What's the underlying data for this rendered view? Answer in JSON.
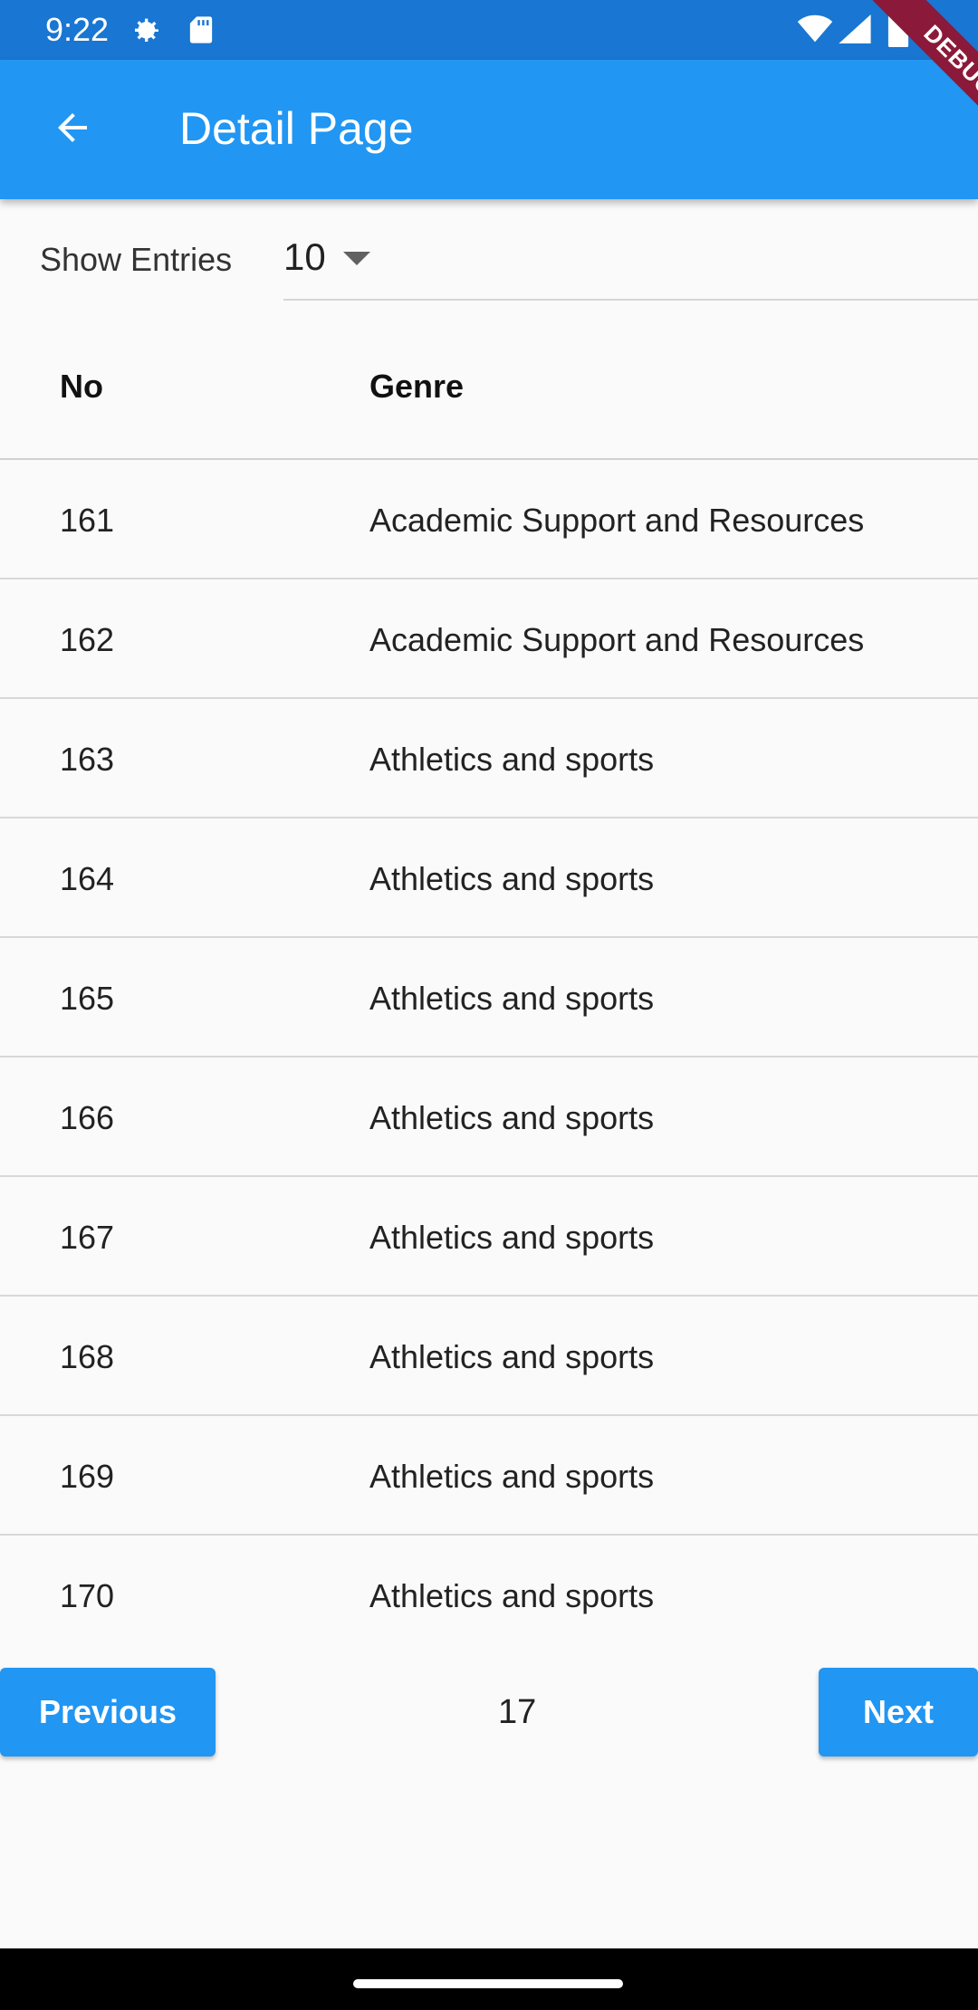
{
  "status_bar": {
    "time": "9:22",
    "icons": [
      "gear-icon",
      "sd-card-icon",
      "wifi-icon",
      "signal-icon",
      "battery-icon"
    ]
  },
  "app_bar": {
    "title": "Detail Page",
    "back_icon": "arrow-back-icon",
    "background": "#2196f3"
  },
  "debug_banner": {
    "label": "DEBUG"
  },
  "entries": {
    "label": "Show Entries",
    "selected": "10"
  },
  "table": {
    "headers": {
      "no": "No",
      "genre": "Genre"
    },
    "rows": [
      {
        "no": "161",
        "genre": "Academic Support and Resources"
      },
      {
        "no": "162",
        "genre": "Academic Support and Resources"
      },
      {
        "no": "163",
        "genre": "Athletics and sports"
      },
      {
        "no": "164",
        "genre": "Athletics and sports"
      },
      {
        "no": "165",
        "genre": "Athletics and sports"
      },
      {
        "no": "166",
        "genre": "Athletics and sports"
      },
      {
        "no": "167",
        "genre": "Athletics and sports"
      },
      {
        "no": "168",
        "genre": "Athletics and sports"
      },
      {
        "no": "169",
        "genre": "Athletics and sports"
      },
      {
        "no": "170",
        "genre": "Athletics and sports"
      }
    ]
  },
  "pagination": {
    "previous_label": "Previous",
    "page": "17",
    "next_label": "Next"
  },
  "colors": {
    "accent": "#2196f3",
    "status_bar": "#1976d2",
    "debug_ribbon": "#8b1a3a"
  }
}
